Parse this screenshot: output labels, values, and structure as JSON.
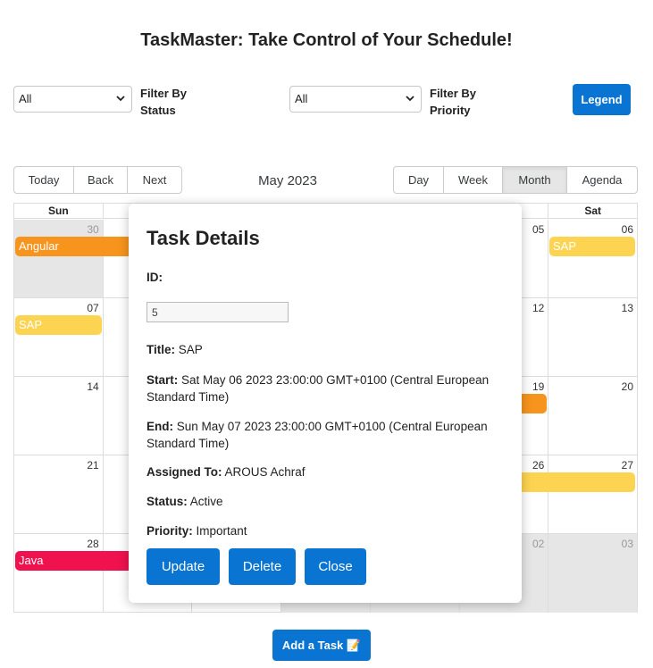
{
  "app": {
    "title": "TaskMaster: Take Control of Your Schedule!"
  },
  "filters": {
    "status": {
      "selected": "All",
      "label": "Filter By Status"
    },
    "priority": {
      "selected": "All",
      "label": "Filter By Priority"
    },
    "legend_button": "Legend"
  },
  "toolbar": {
    "nav": [
      "Today",
      "Back",
      "Next"
    ],
    "label": "May 2023",
    "views": [
      "Day",
      "Week",
      "Month",
      "Agenda"
    ],
    "active_view": "Month"
  },
  "calendar": {
    "day_headers": [
      "Sun",
      "",
      "",
      "",
      "",
      "",
      "Sat"
    ],
    "weeks": [
      [
        "30",
        "",
        "",
        "",
        "",
        "05",
        "06"
      ],
      [
        "07",
        "",
        "",
        "",
        "",
        "12",
        "13"
      ],
      [
        "14",
        "",
        "",
        "",
        "",
        "19",
        "20"
      ],
      [
        "21",
        "",
        "",
        "",
        "",
        "26",
        "27"
      ],
      [
        "28",
        "",
        "",
        "",
        "",
        "02",
        "03"
      ]
    ],
    "events": [
      {
        "title": "Angular",
        "color": "#f7941d"
      },
      {
        "title": "SAP",
        "color": "#fdd451"
      },
      {
        "title": "SAP",
        "color": "#fdd451"
      },
      {
        "title": "",
        "color": "#f7941d"
      },
      {
        "title": "",
        "color": "#fdd451"
      },
      {
        "title": "Java",
        "color": "#f0114f"
      }
    ]
  },
  "modal": {
    "heading": "Task Details",
    "id_label": "ID:",
    "id_value": "5",
    "title_label": "Title:",
    "title_value": " SAP",
    "start_label": "Start:",
    "start_value": " Sat May 06 2023 23:00:00 GMT+0100 (Central European Standard Time)",
    "end_label": "End:",
    "end_value": " Sun May 07 2023 23:00:00 GMT+0100 (Central European Standard Time)",
    "assigned_label": "Assigned To:",
    "assigned_value": " AROUS Achraf",
    "status_label": "Status:",
    "status_value": " Active",
    "priority_label": "Priority:",
    "priority_value": " Important",
    "buttons": {
      "update": "Update",
      "delete": "Delete",
      "close": "Close"
    }
  },
  "add_task_button": "Add a Task 📝",
  "colors": {
    "primary": "#0a74d3",
    "offrange": "#e6e6e6"
  }
}
